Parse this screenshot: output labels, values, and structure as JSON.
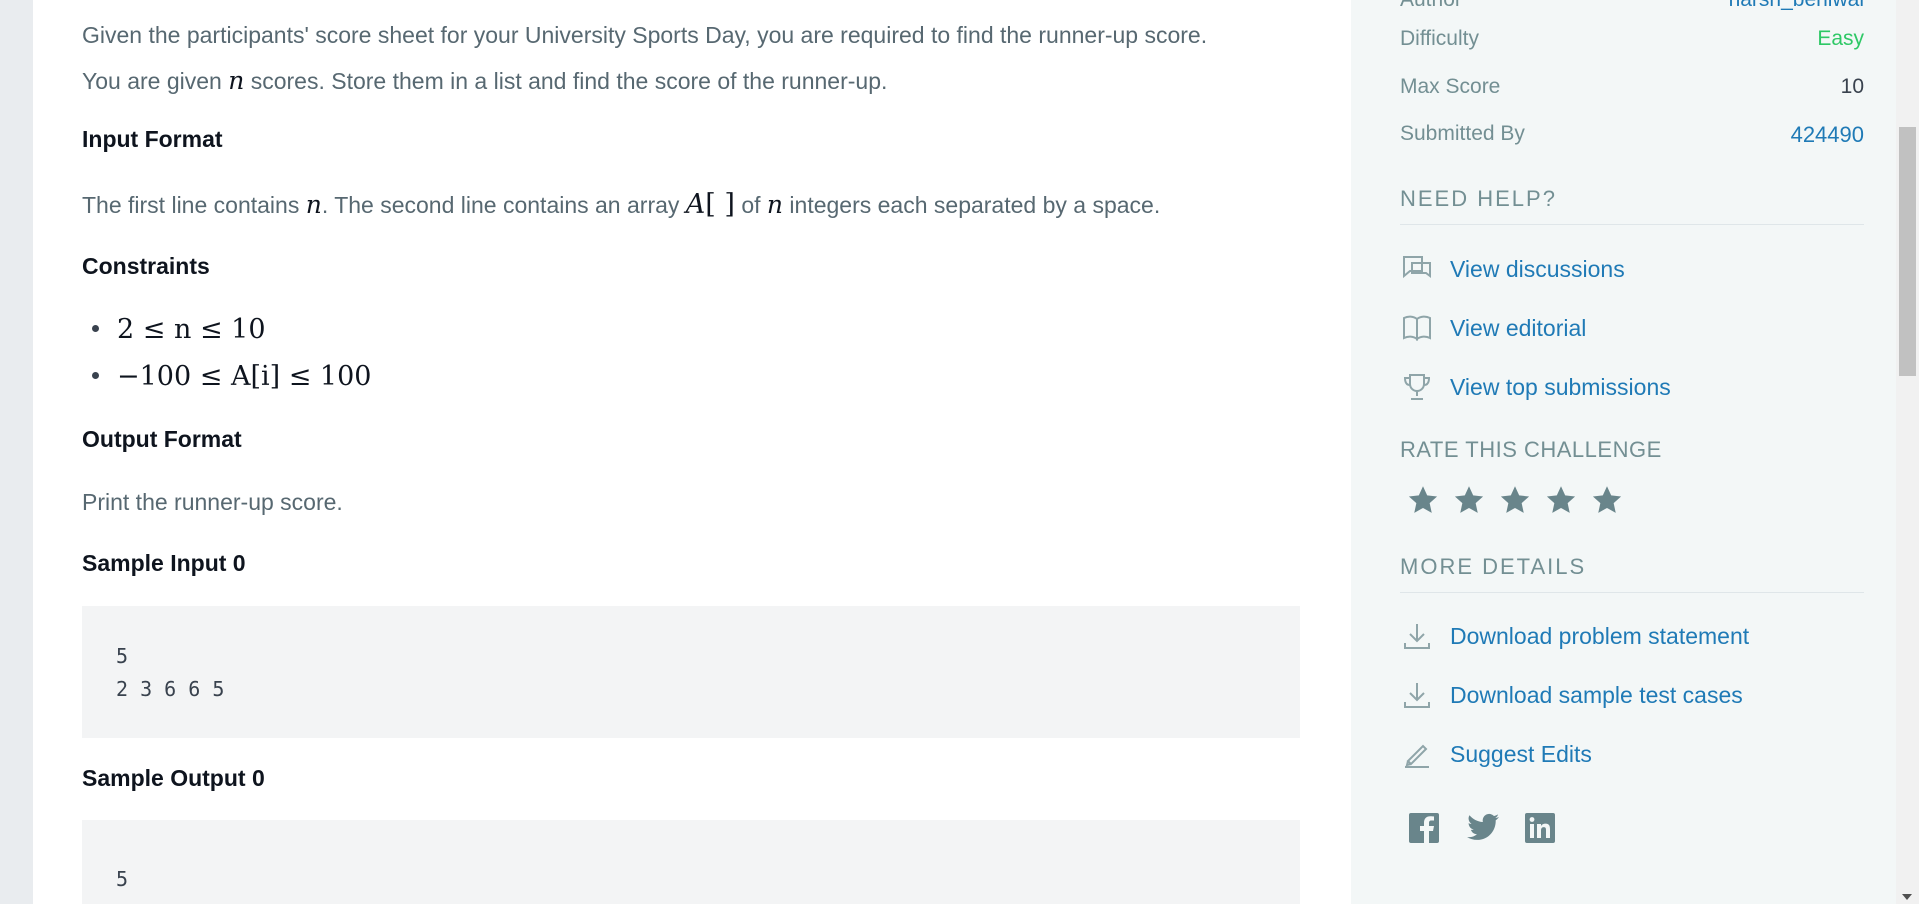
{
  "problem": {
    "intro_1": "Given the participants' score sheet for your University Sports Day, you are required to find the runner-up score.",
    "intro_2a": "You are given ",
    "intro_2_var": "n",
    "intro_2b": " scores. Store them in a list and find the score of the runner-up.",
    "input_heading": "Input Format",
    "input_a": "The first line contains ",
    "input_var_n": "n",
    "input_b": ". The second line contains an array ",
    "input_var_A": "A",
    "input_brackets": "[ ]",
    "input_c": " of ",
    "input_var_n2": "n",
    "input_d": " integers each separated by a space.",
    "constraints_heading": "Constraints",
    "constraints": [
      "2 ≤ n ≤ 10",
      "−100 ≤ A[i] ≤ 100"
    ],
    "output_heading": "Output Format",
    "output_text": "Print the runner-up score.",
    "sample_input_heading": "Sample Input 0",
    "sample_input": "5\n2 3 6 6 5",
    "sample_output_heading": "Sample Output 0",
    "sample_output": "5"
  },
  "sidebar": {
    "author_label": "Author",
    "author_value": "harsh_beniwal",
    "difficulty_label": "Difficulty",
    "difficulty_value": "Easy",
    "max_score_label": "Max Score",
    "max_score_value": "10",
    "submitted_by_label": "Submitted By",
    "submitted_by_value": "424490",
    "need_help_heading": "NEED HELP?",
    "help_links": [
      "View discussions",
      "View editorial",
      "View top submissions"
    ],
    "rate_heading": "RATE THIS CHALLENGE",
    "rating_stars_total": 5,
    "more_details_heading": "MORE DETAILS",
    "detail_links": [
      "Download problem statement",
      "Download sample test cases",
      "Suggest Edits"
    ],
    "social": [
      "facebook-icon",
      "twitter-icon",
      "linkedin-icon"
    ]
  },
  "colors": {
    "link": "#1f7ab6",
    "easy": "#2ec866",
    "label": "#738f93",
    "icon": "#69858b"
  }
}
